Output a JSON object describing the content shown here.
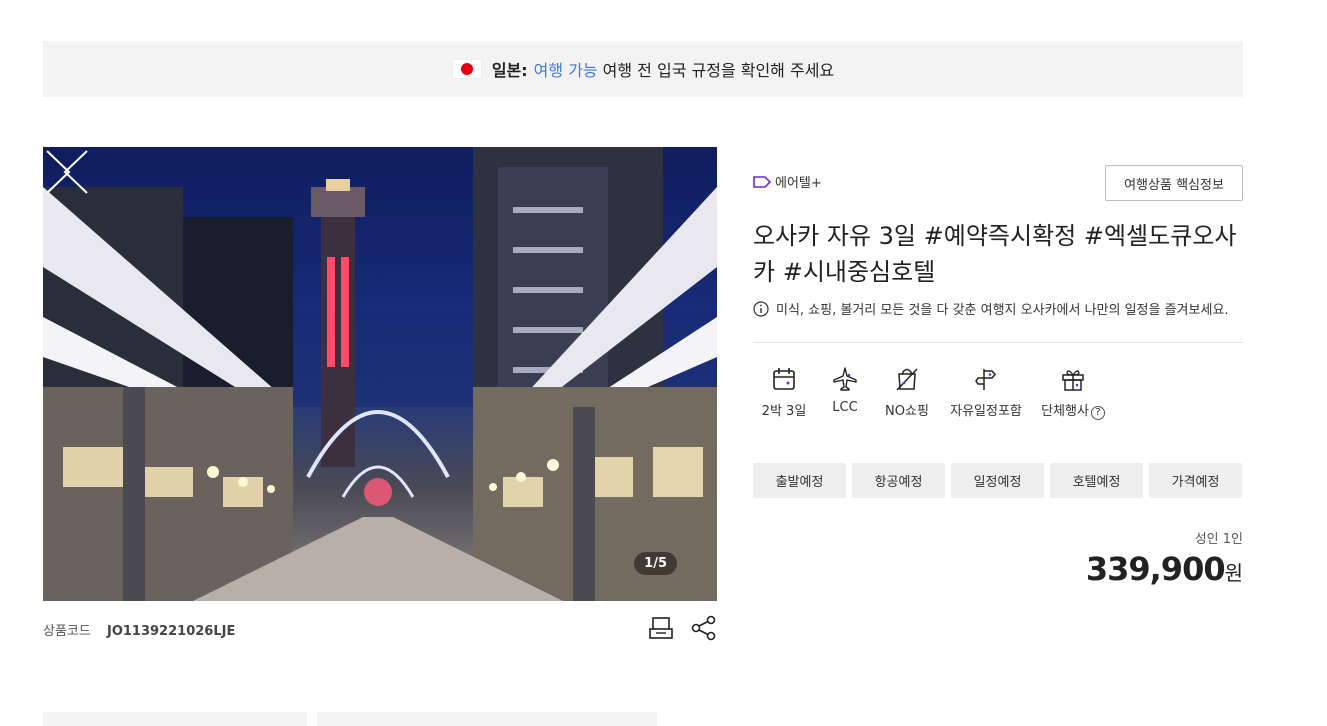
{
  "notice": {
    "country": "일본:",
    "status": "여행 가능",
    "message": "여행 전 입국 규정을 확인해 주세요"
  },
  "gallery": {
    "counter": "1/5"
  },
  "product": {
    "code_label": "상품코드",
    "code_value": "JO1139221026LJE"
  },
  "info": {
    "tag": "에어텔+",
    "keyinfo_button": "여행상품 핵심정보",
    "title": "오사카 자유 3일 #예약즉시확정 #엑셀도큐오사카 #시내중심호텔",
    "description": "미식, 쇼핑, 볼거리 모든 것을 다 갖춘 여행지 오사카에서 나만의 일정을 즐겨보세요."
  },
  "features": [
    {
      "label": "2박 3일",
      "icon": "calendar-icon"
    },
    {
      "label": "LCC",
      "icon": "airplane-icon"
    },
    {
      "label": "NO쇼핑",
      "icon": "no-shopping-icon"
    },
    {
      "label": "자유일정포함",
      "icon": "signpost-icon"
    },
    {
      "label": "단체행사",
      "icon": "gift-icon"
    }
  ],
  "tabs": [
    "출발예정",
    "항공예정",
    "일정예정",
    "호텔예정",
    "가격예정"
  ],
  "price": {
    "label": "성인 1인",
    "amount": "339,900",
    "unit": "원"
  },
  "colors": {
    "accent_blue": "#3d7ce0",
    "tag_purple": "#6b2bd9",
    "flag_red": "#e60012"
  }
}
